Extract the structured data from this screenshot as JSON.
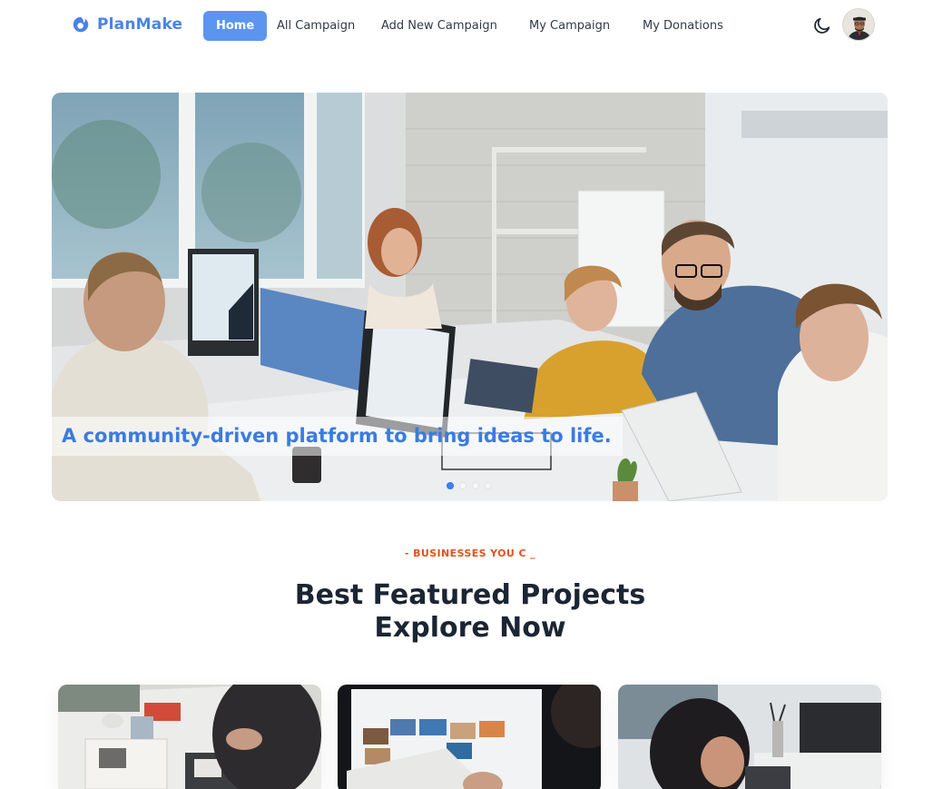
{
  "brand": {
    "name": "PlanMake",
    "color": "#4a83e6"
  },
  "nav": {
    "items": [
      {
        "label": "Home",
        "active": true
      },
      {
        "label": "All Campaign",
        "active": false
      },
      {
        "label": "Add New Campaign",
        "active": false
      },
      {
        "label": "My Campaign",
        "active": false
      },
      {
        "label": "My Donations",
        "active": false
      }
    ],
    "theme_toggle_icon": "moon-icon",
    "avatar_icon": "user-avatar"
  },
  "hero": {
    "caption": "A community-driven platform to bring ideas to life.",
    "slide_count": 4,
    "active_slide": 1
  },
  "section": {
    "eyebrow": "- BUSINESSES YOU C _",
    "title_line1": "Best Featured Projects",
    "title_line2": "Explore Now"
  },
  "projects": [
    {
      "image": "craft-table-photo"
    },
    {
      "image": "photo-gallery-monitor-photo"
    },
    {
      "image": "woman-at-desk-photo"
    }
  ],
  "colors": {
    "accent": "#5b95ee",
    "eyebrow": "#e0531d",
    "heading": "#1c2533"
  }
}
